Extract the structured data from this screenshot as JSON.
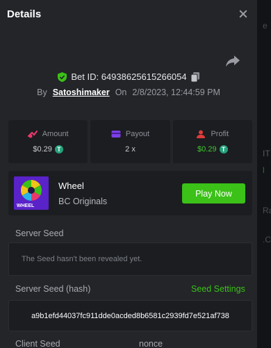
{
  "modal": {
    "title": "Details"
  },
  "bet": {
    "id_text": "Bet ID: 64938625615266054",
    "by_label": "By",
    "user": "Satoshimaker",
    "on_label": "On",
    "datetime": "2/8/2023, 12:44:59 PM"
  },
  "stats": {
    "amount": {
      "label": "Amount",
      "value": "$0.29",
      "coin": "T"
    },
    "payout": {
      "label": "Payout",
      "value": "2 x"
    },
    "profit": {
      "label": "Profit",
      "value": "$0.29",
      "coin": "T"
    }
  },
  "game": {
    "name": "Wheel",
    "provider": "BC Originals",
    "thumb_text": "WHEEL",
    "play_label": "Play Now"
  },
  "seeds": {
    "server_seed_label": "Server Seed",
    "server_seed_placeholder": "The Seed hasn't been revealed yet.",
    "server_hash_label": "Server Seed (hash)",
    "seed_settings_label": "Seed Settings",
    "server_hash_value": "a9b1efd44037fc911dde0acded8b6581c2939fd7e521af738",
    "client_seed_label": "Client Seed",
    "nonce_label": "nonce"
  },
  "colors": {
    "accent_green": "#3bc117",
    "amount_icon": "#e8386b",
    "payout_icon": "#7b3fe4",
    "profit_icon": "#e03b3b",
    "tether": "#26a17b"
  }
}
